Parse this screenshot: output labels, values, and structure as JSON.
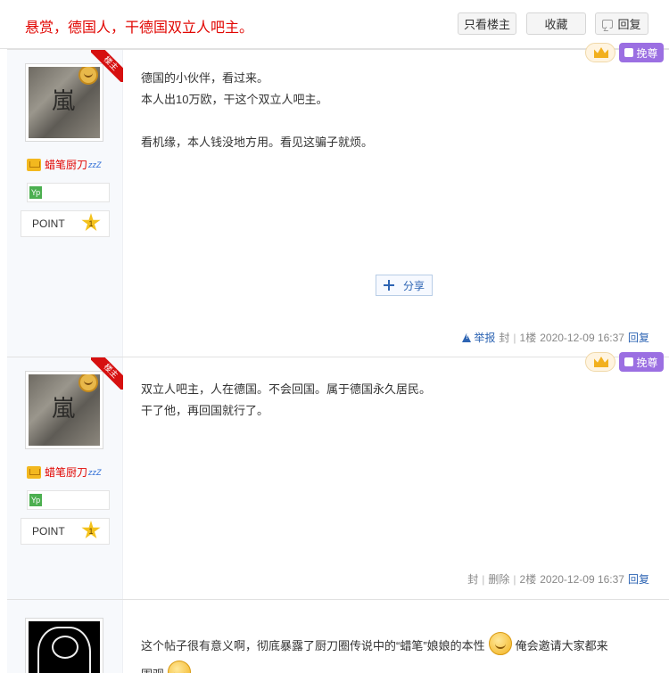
{
  "header": {
    "title": "悬赏，德国人，干德国双立人吧主。",
    "only_op_label": "只看楼主",
    "favorite_label": "收藏",
    "reply_label": "回复"
  },
  "posts": [
    {
      "ribbon": "楼主",
      "username": "蜡笔厨刀",
      "level_badge": "Yp",
      "point_label": "POINT",
      "point_value": "1",
      "avatar_glyph": "嵐",
      "tag_label": "挽尊",
      "lines": [
        "德国的小伙伴，看过来。",
        "本人出10万欧，干这个双立人吧主。",
        "",
        "看机缘，本人钱没地方用。看见这骗子就烦。"
      ],
      "share_label": "分享",
      "report_label": "举报",
      "seal_label": "封",
      "floor": "1楼",
      "time": "2020-12-09 16:37",
      "reply_label": "回复"
    },
    {
      "ribbon": "楼主",
      "username": "蜡笔厨刀",
      "level_badge": "Yp",
      "point_label": "POINT",
      "point_value": "1",
      "avatar_glyph": "嵐",
      "tag_label": "挽尊",
      "lines": [
        "双立人吧主，人在德国。不会回国。属于德国永久居民。",
        "干了他，再回国就行了。"
      ],
      "seal_label": "封",
      "delete_label": "删除",
      "floor": "2楼",
      "time": "2020-12-09 16:37",
      "reply_label": "回复"
    },
    {
      "line1_a": "这个帖子很有意义啊，彻底暴露了厨刀圈传说中的“蜡笔”娘娘的本性",
      "line1_b": "俺会邀请大家都来",
      "line2": "围观"
    }
  ],
  "colors": {
    "title_red": "#e10602",
    "link_blue": "#2d64b3",
    "ribbon_red": "#d61010",
    "tag_purple": "#9b6fe2",
    "sidebar_bg": "#f7f9fc"
  }
}
